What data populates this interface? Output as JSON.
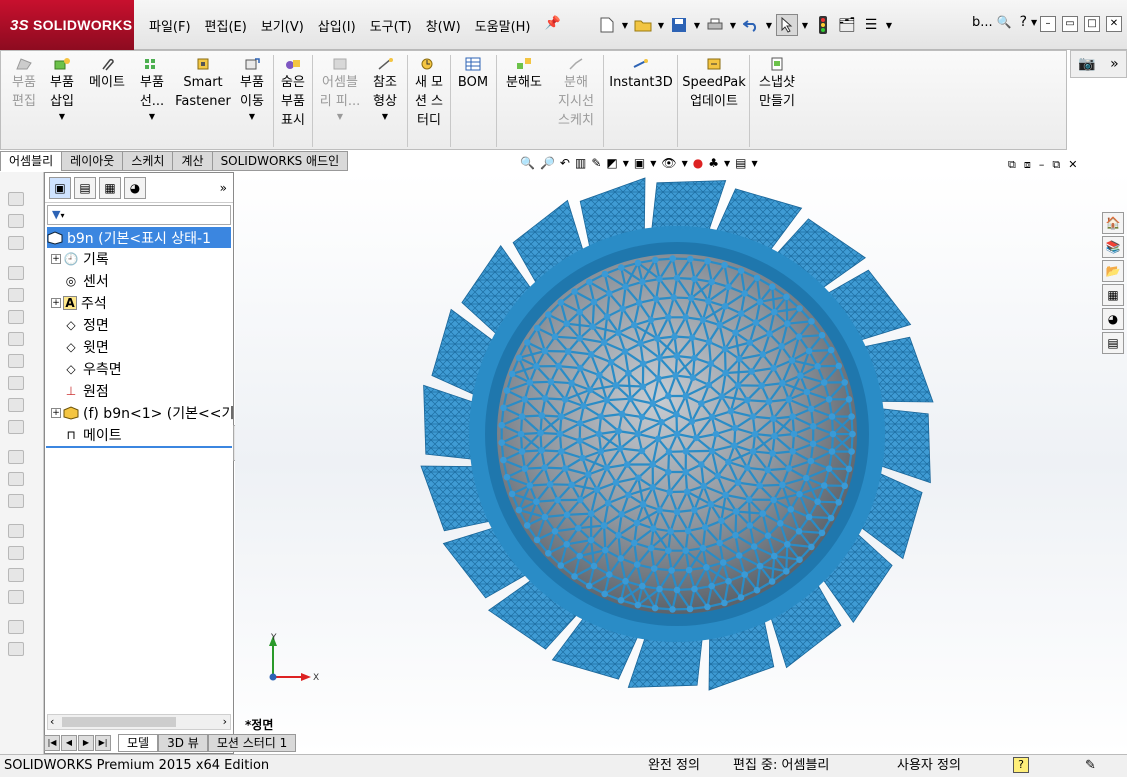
{
  "app": {
    "brand_ds": "3S",
    "brand_name": "SOLIDWORKS"
  },
  "menu": [
    "파일(F)",
    "편집(E)",
    "보기(V)",
    "삽입(I)",
    "도구(T)",
    "창(W)",
    "도움말(H)"
  ],
  "quick_access": {
    "search_label": "b...",
    "help_label": "?"
  },
  "commands": [
    {
      "label1": "부품",
      "label2": "편집",
      "enabled": false
    },
    {
      "label1": "부품",
      "label2": "삽입",
      "enabled": true,
      "drop": true
    },
    {
      "label1": "메이트",
      "label2": "",
      "enabled": true
    },
    {
      "label1": "부품",
      "label2": "선...",
      "enabled": true,
      "drop": true
    },
    {
      "label1": "Smart",
      "label2": "Fastener",
      "enabled": true
    },
    {
      "label1": "부품",
      "label2": "이동",
      "enabled": true,
      "drop": true
    },
    {
      "label1": "숨은",
      "label2": "부품",
      "label3": "표시",
      "enabled": true
    },
    {
      "label1": "어셈블",
      "label2": "리 피...",
      "enabled": false,
      "drop": true
    },
    {
      "label1": "참조",
      "label2": "형상",
      "enabled": true,
      "drop": true
    },
    {
      "label1": "새 모",
      "label2": "션 스",
      "label3": "터디",
      "enabled": true
    },
    {
      "label1": "BOM",
      "label2": "",
      "enabled": true
    },
    {
      "label1": "분해도",
      "label2": "",
      "enabled": true
    },
    {
      "label1": "분해",
      "label2": "지시선",
      "label3": "스케치",
      "enabled": false
    },
    {
      "label1": "Instant3D",
      "label2": "",
      "enabled": true
    },
    {
      "label1": "SpeedPak",
      "label2": "업데이트",
      "enabled": true
    },
    {
      "label1": "스냅샷",
      "label2": "만들기",
      "enabled": true
    }
  ],
  "tabs": [
    "어셈블리",
    "레이아웃",
    "스케치",
    "계산",
    "SOLIDWORKS 애드인"
  ],
  "tree": {
    "root": "b9n  (기본<표시 상태-1",
    "items": [
      "기록",
      "센서",
      "주석",
      "정면",
      "윗면",
      "우측면",
      "원점",
      "(f) b9n<1> (기본<<기",
      "메이트"
    ]
  },
  "view": {
    "name": "*정면",
    "axis_x": "X",
    "axis_y": "Y"
  },
  "bottom_tabs": [
    "모델",
    "3D 뷰",
    "모션 스터디 1"
  ],
  "status": {
    "edition": "SOLIDWORKS Premium 2015 x64 Edition",
    "definition": "완전 정의",
    "editing": "편집 중: 어셈블리",
    "custom": "사용자 정의",
    "help": "?"
  },
  "colors": {
    "model_blue": "#2a8cc6",
    "sphere_gray": "#8f969e",
    "selection": "#3b86e0",
    "logo_red": "#c8102e"
  }
}
